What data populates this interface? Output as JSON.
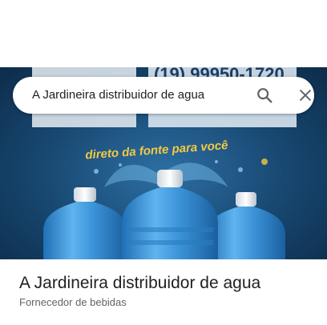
{
  "search": {
    "query": "A Jardineira distribuidor de agua",
    "search_icon": "magnifier-icon",
    "close_icon": "close-icon"
  },
  "hero": {
    "phone_text": "(19) 99950-1720",
    "slogan": "direto da fonte para você",
    "colors": {
      "background": "#17466f",
      "slogan": "#f5c842",
      "water": "#4fa7e6"
    }
  },
  "place": {
    "name": "A Jardineira distribuidor de agua",
    "category": "Fornecedor de bebidas"
  }
}
